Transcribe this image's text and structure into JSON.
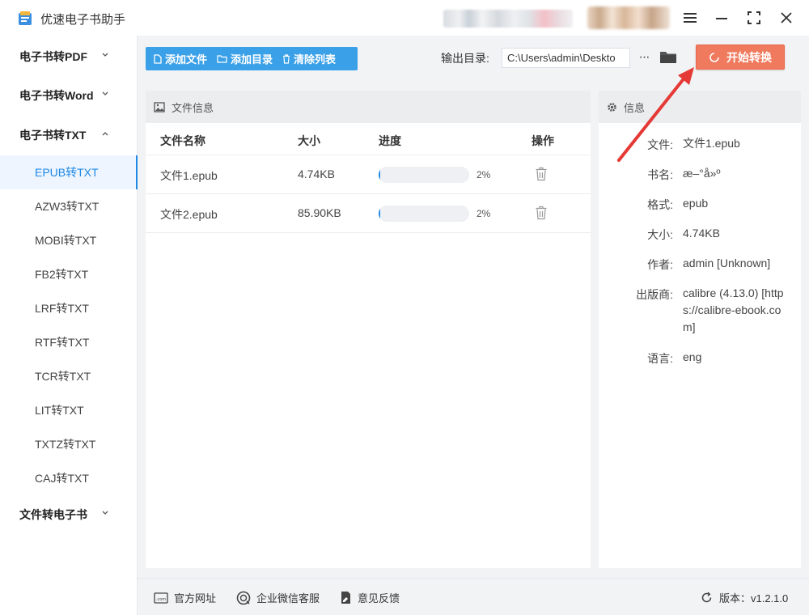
{
  "app": {
    "title": "优速电子书助手"
  },
  "window": {
    "menu_icon": "menu-icon",
    "min_icon": "minimize-icon",
    "max_icon": "maximize-icon",
    "close_icon": "close-icon"
  },
  "sidebar": {
    "categories": [
      {
        "label": "电子书转PDF",
        "expanded": false
      },
      {
        "label": "电子书转Word",
        "expanded": false
      },
      {
        "label": "电子书转TXT",
        "expanded": true
      },
      {
        "label": "文件转电子书",
        "expanded": false
      }
    ],
    "items": [
      {
        "label": "EPUB转TXT",
        "active": true
      },
      {
        "label": "AZW3转TXT"
      },
      {
        "label": "MOBI转TXT"
      },
      {
        "label": "FB2转TXT"
      },
      {
        "label": "LRF转TXT"
      },
      {
        "label": "RTF转TXT"
      },
      {
        "label": "TCR转TXT"
      },
      {
        "label": "LIT转TXT"
      },
      {
        "label": "TXTZ转TXT"
      },
      {
        "label": "CAJ转TXT"
      }
    ]
  },
  "toolbar": {
    "add_file": "添加文件",
    "add_dir": "添加目录",
    "clear_list": "清除列表",
    "output_label": "输出目录:",
    "output_path": "C:\\Users\\admin\\Deskto",
    "more": "···",
    "start": "开始转换"
  },
  "file_panel": {
    "title": "文件信息",
    "columns": {
      "name": "文件名称",
      "size": "大小",
      "progress": "进度",
      "action": "操作"
    },
    "files": [
      {
        "name": "文件1.epub",
        "size": "4.74KB",
        "progress": 0.02,
        "progress_label": "2%"
      },
      {
        "name": "文件2.epub",
        "size": "85.90KB",
        "progress": 0.02,
        "progress_label": "2%"
      }
    ]
  },
  "info_panel": {
    "title": "信息",
    "rows": [
      {
        "key": "文件:",
        "value": "文件1.epub"
      },
      {
        "key": "书名:",
        "value": "æ–°å»º"
      },
      {
        "key": "格式:",
        "value": "epub"
      },
      {
        "key": "大小:",
        "value": "4.74KB"
      },
      {
        "key": "作者:",
        "value": "admin [Unknown]"
      },
      {
        "key": "出版商:",
        "value": "calibre (4.13.0) [https://calibre-ebook.com]"
      },
      {
        "key": "语言:",
        "value": "eng"
      }
    ]
  },
  "footer": {
    "website": "官方网址",
    "wechat": "企业微信客服",
    "feedback": "意见反馈",
    "version": "版本：v1.2.1.0"
  },
  "colors": {
    "accent": "#1e88e5",
    "toolbar": "#3aa0e8",
    "start": "#f07a5e",
    "annotation": "#e53935"
  }
}
